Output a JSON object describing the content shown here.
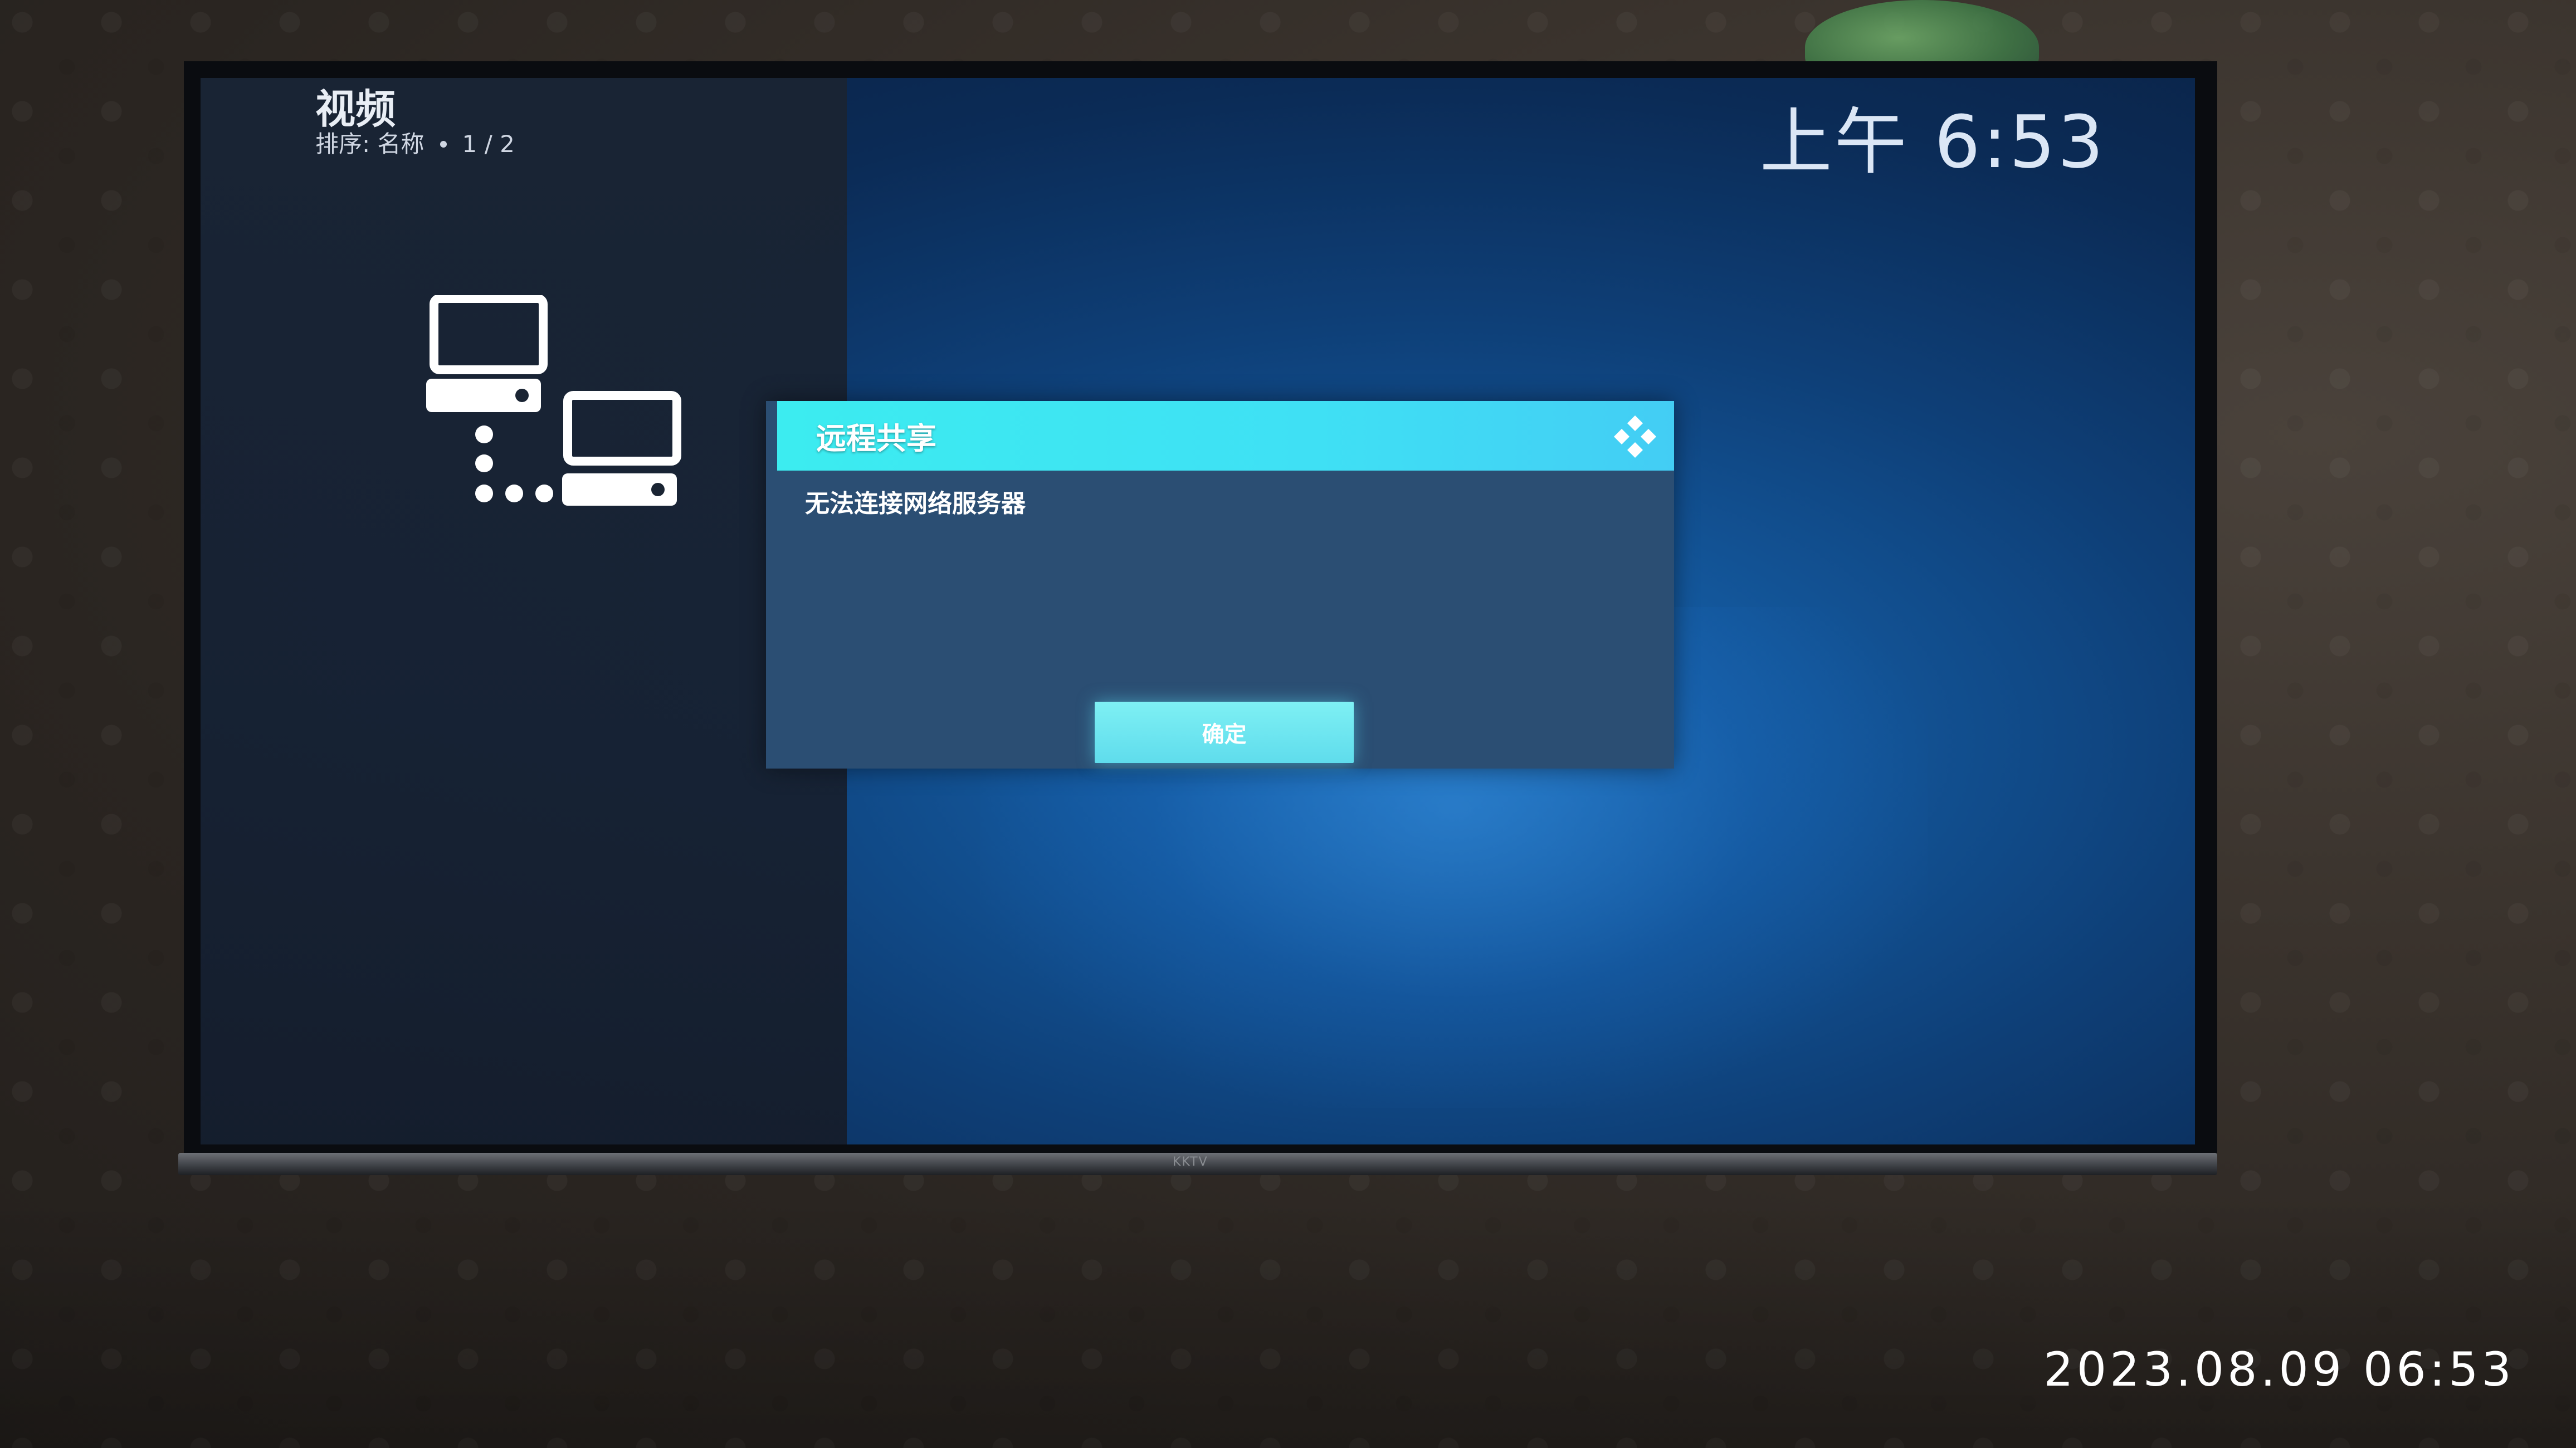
{
  "header": {
    "title": "视频",
    "sort_label": "排序: 名称",
    "page": "1 / 2"
  },
  "clock": "上午 6:53",
  "dialog": {
    "title": "远程共享",
    "message": "无法连接网络服务器",
    "ok_label": "确定"
  },
  "tv": {
    "brand": "KKTV"
  },
  "photo_timestamp": "2023.08.09 06:53",
  "colors": {
    "dialog_title_bg": "#3fe0f4",
    "dialog_body_bg": "#2b4e73",
    "screen_bg": "#0e3f77",
    "left_panel_bg": "#172131"
  },
  "icons": {
    "network": "network-computers-icon",
    "kodi": "kodi-logo-icon"
  }
}
